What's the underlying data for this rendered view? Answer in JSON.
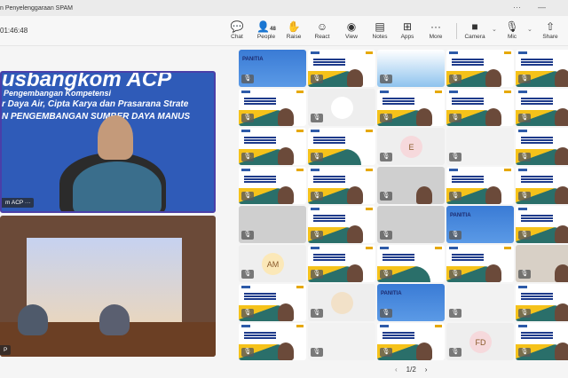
{
  "window": {
    "title": "n Penyelenggaraan SPAM",
    "more": "···",
    "minimize": "—"
  },
  "toolbar": {
    "timer": "01:46:48",
    "buttons": [
      {
        "label": "Chat",
        "icon": "chat-icon",
        "glyph": "💬"
      },
      {
        "label": "People",
        "icon": "people-icon",
        "glyph": "👤",
        "badge": "48"
      },
      {
        "label": "Raise",
        "icon": "hand-icon",
        "glyph": "✋"
      },
      {
        "label": "React",
        "icon": "smile-icon",
        "glyph": "☺"
      },
      {
        "label": "View",
        "icon": "view-icon",
        "glyph": "◉"
      },
      {
        "label": "Notes",
        "icon": "notes-icon",
        "glyph": "▤"
      },
      {
        "label": "Apps",
        "icon": "apps-icon",
        "glyph": "⊞"
      },
      {
        "label": "More",
        "icon": "more-icon",
        "glyph": "···"
      },
      {
        "label": "Camera",
        "icon": "camera-icon",
        "glyph": "■"
      },
      {
        "label": "Mic",
        "icon": "mic-off-icon",
        "glyph": "🎙"
      },
      {
        "label": "Share",
        "icon": "share-icon",
        "glyph": "⇧"
      }
    ]
  },
  "stage": {
    "speaker": {
      "banner_title": "usbangkom ACP",
      "line1": "Pengembangan Kompetensi",
      "line2": "r Daya Air, Cipta Karya dan Prasarana Strate",
      "line3": "N PENGEMBANGAN SUMBER DAYA MANUS",
      "name": "m ACP ··· "
    },
    "room": {
      "name": "P"
    }
  },
  "grid": {
    "tiles": [
      {
        "kind": "panitia",
        "text": "PANITIA"
      },
      {
        "kind": "slide",
        "face": true
      },
      {
        "kind": "banner"
      },
      {
        "kind": "slide",
        "face": true
      },
      {
        "kind": "slide",
        "face": true
      },
      {
        "kind": "slide",
        "face": true
      },
      {
        "kind": "avatar",
        "initials": "",
        "color": "#ffffff"
      },
      {
        "kind": "slide",
        "face": true
      },
      {
        "kind": "slide",
        "face": true
      },
      {
        "kind": "slide",
        "face": true
      },
      {
        "kind": "slide",
        "face": true
      },
      {
        "kind": "slide"
      },
      {
        "kind": "avatar",
        "initials": "E",
        "color": "#f6d9dc"
      },
      {
        "kind": "blank"
      },
      {
        "kind": "slide",
        "face": true
      },
      {
        "kind": "slide",
        "face": true
      },
      {
        "kind": "slide",
        "face": true
      },
      {
        "kind": "gray",
        "face": true
      },
      {
        "kind": "slide",
        "face": true
      },
      {
        "kind": "slide",
        "face": true
      },
      {
        "kind": "gray"
      },
      {
        "kind": "slide",
        "face": true
      },
      {
        "kind": "gray"
      },
      {
        "kind": "panitia",
        "text": "PANITIA"
      },
      {
        "kind": "slide",
        "face": true
      },
      {
        "kind": "avatar",
        "initials": "AM",
        "color": "#fbe8b8"
      },
      {
        "kind": "slide",
        "face": true
      },
      {
        "kind": "slide"
      },
      {
        "kind": "slide",
        "face": true
      },
      {
        "kind": "room",
        "face": true
      },
      {
        "kind": "slide",
        "face": true
      },
      {
        "kind": "avatar",
        "initials": "",
        "color": "#f2e1c8"
      },
      {
        "kind": "panitia",
        "text": "PANITIA"
      },
      {
        "kind": "blank"
      },
      {
        "kind": "slide",
        "face": true
      },
      {
        "kind": "slide",
        "face": true
      },
      {
        "kind": "blank"
      },
      {
        "kind": "slide",
        "face": true
      },
      {
        "kind": "avatar",
        "initials": "FD",
        "color": "#f6d9dc"
      },
      {
        "kind": "slide",
        "face": true
      }
    ]
  },
  "pager": {
    "prev": "‹",
    "page": "1/2",
    "next": "›"
  }
}
